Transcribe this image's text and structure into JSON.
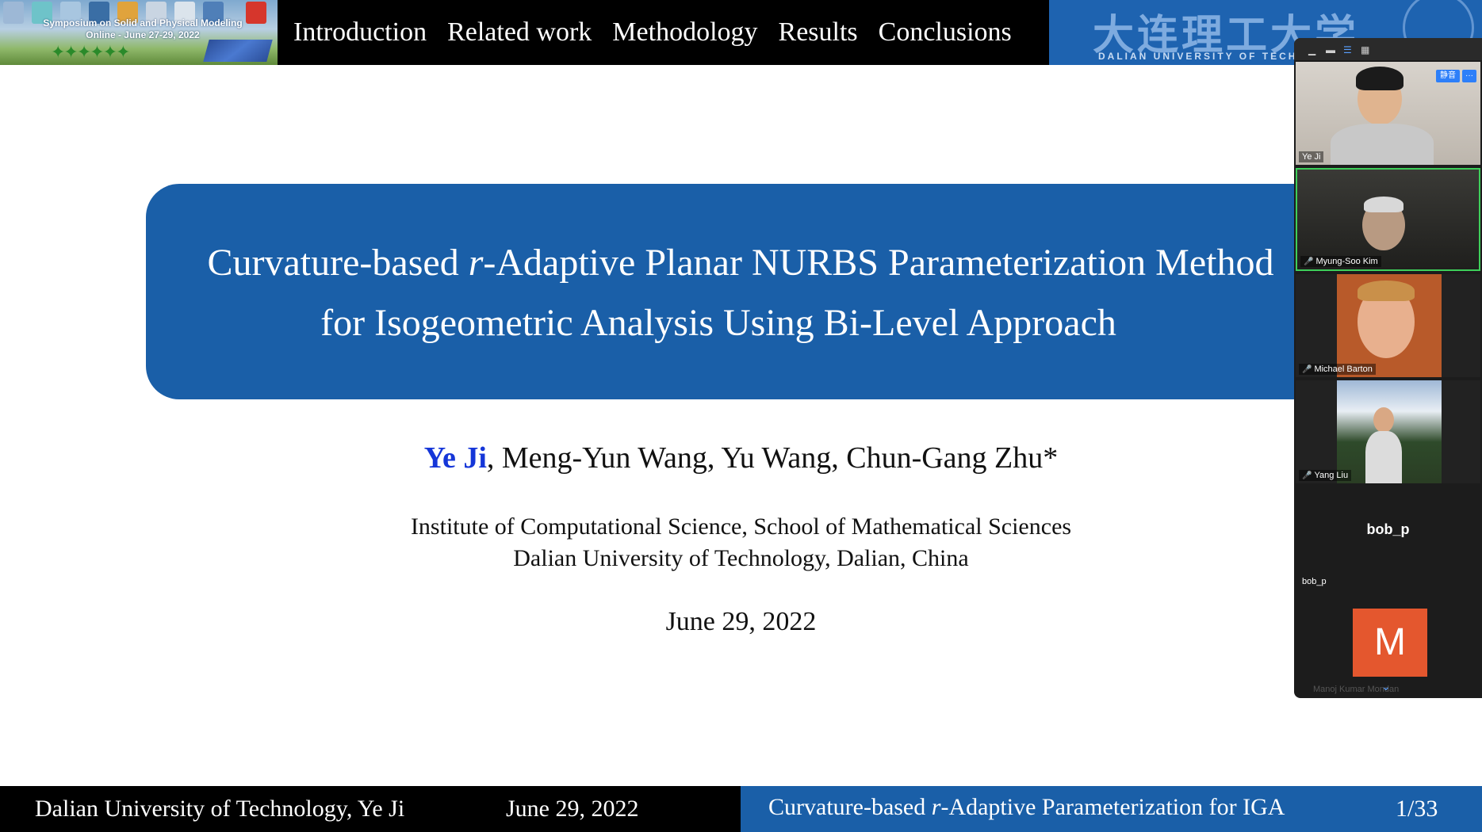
{
  "conference": {
    "banner_line1": "Symposium on Solid and Physical Modeling",
    "banner_line2": "Online - June 27-29, 2022"
  },
  "nav": {
    "tabs": [
      "Introduction",
      "Related work",
      "Methodology",
      "Results",
      "Conclusions"
    ]
  },
  "university_logo": {
    "chinese": "大连理工大学",
    "english": "DALIAN UNIVERSITY OF TECHNOLOGY"
  },
  "slide": {
    "title_line1_pre": "Curvature-based ",
    "title_line1_var": "r",
    "title_line1_post": "-Adaptive Planar NURBS Parameterization Method",
    "title_line2": "for Isogeometric Analysis Using Bi-Level Approach",
    "presenter": "Ye Ji",
    "coauthors": ", Meng-Yun Wang, Yu Wang, Chun-Gang Zhu*",
    "affiliation_line1": "Institute of Computational Science, School of Mathematical Sciences",
    "affiliation_line2": "Dalian University of Technology, Dalian, China",
    "date": "June 29, 2022"
  },
  "footer": {
    "institution": "Dalian University of Technology, Ye Ji",
    "date": "June 29, 2022",
    "title_pre": "Curvature-based ",
    "title_var": "r",
    "title_post": "-Adaptive Parameterization for IGA",
    "page": "1/33"
  },
  "zoom": {
    "mute_badge": "静音",
    "more_badge": "···",
    "participants": [
      {
        "name": "Ye Ji",
        "muted": false,
        "video": true,
        "active": false
      },
      {
        "name": "Myung-Soo Kim",
        "muted": true,
        "video": true,
        "active": true
      },
      {
        "name": "Michael Barton",
        "muted": true,
        "video": true,
        "active": false
      },
      {
        "name": "Yang Liu",
        "muted": true,
        "video": true,
        "active": false
      },
      {
        "name": "bob_p",
        "display": "bob_p",
        "muted": false,
        "video": false,
        "active": false
      },
      {
        "name": "Manoj Kumar Mondan",
        "avatar_letter": "M",
        "muted": false,
        "video": false,
        "active": false
      }
    ]
  },
  "colors": {
    "title_box": "#1a5fa8",
    "presenter_name": "#1536d8",
    "active_speaker_border": "#3ecf5a",
    "avatar_m": "#e4572e"
  }
}
